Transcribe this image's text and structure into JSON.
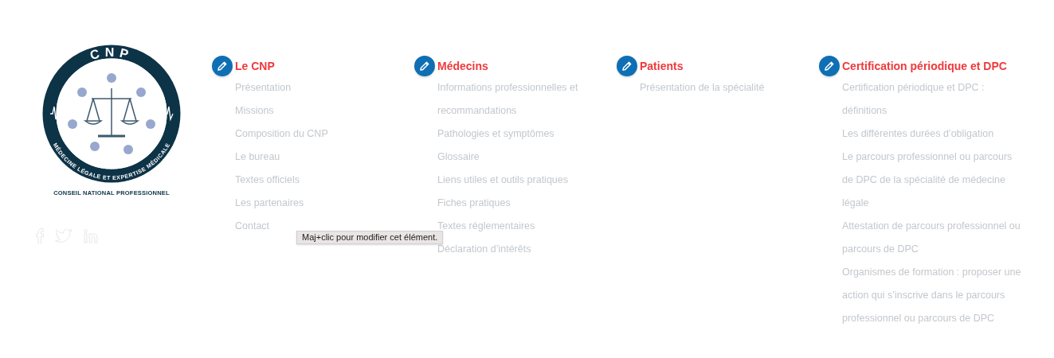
{
  "logo": {
    "top_text": "CNP",
    "ring_text": "MÉDECINE LÉGALE ET EXPERTISE MÉDICALE",
    "caption": "CONSEIL NATIONAL PROFESSIONNEL"
  },
  "menus": [
    {
      "title": "Le CNP",
      "items": [
        "Présentation",
        "Missions",
        "Composition du CNP",
        "Le bureau",
        "Textes officiels",
        "Les partenaires",
        "Contact"
      ]
    },
    {
      "title": "Médecins",
      "items": [
        "Informations professionnelles et recommandations",
        "Pathologies et symptômes",
        "Glossaire",
        "Liens utiles et outils pratiques",
        "Fiches pratiques",
        "Textes réglementaires",
        "Déclaration d’intérêts"
      ]
    },
    {
      "title": "Patients",
      "items": [
        "Présentation de la spécialité"
      ]
    },
    {
      "title": "Certification périodique et DPC",
      "items": [
        "Certification périodique et DPC : définitions",
        "Les différentes durées d’obligation",
        "Le parcours professionnel ou parcours de DPC de la spécialité de médecine légale",
        "Attestation de parcours professionnel ou parcours de DPC",
        "Organismes de formation : proposer une action qui s’inscrive dans le parcours professionnel ou parcours de DPC"
      ]
    }
  ],
  "tooltip": "Maj+clic pour modifier cet élément."
}
